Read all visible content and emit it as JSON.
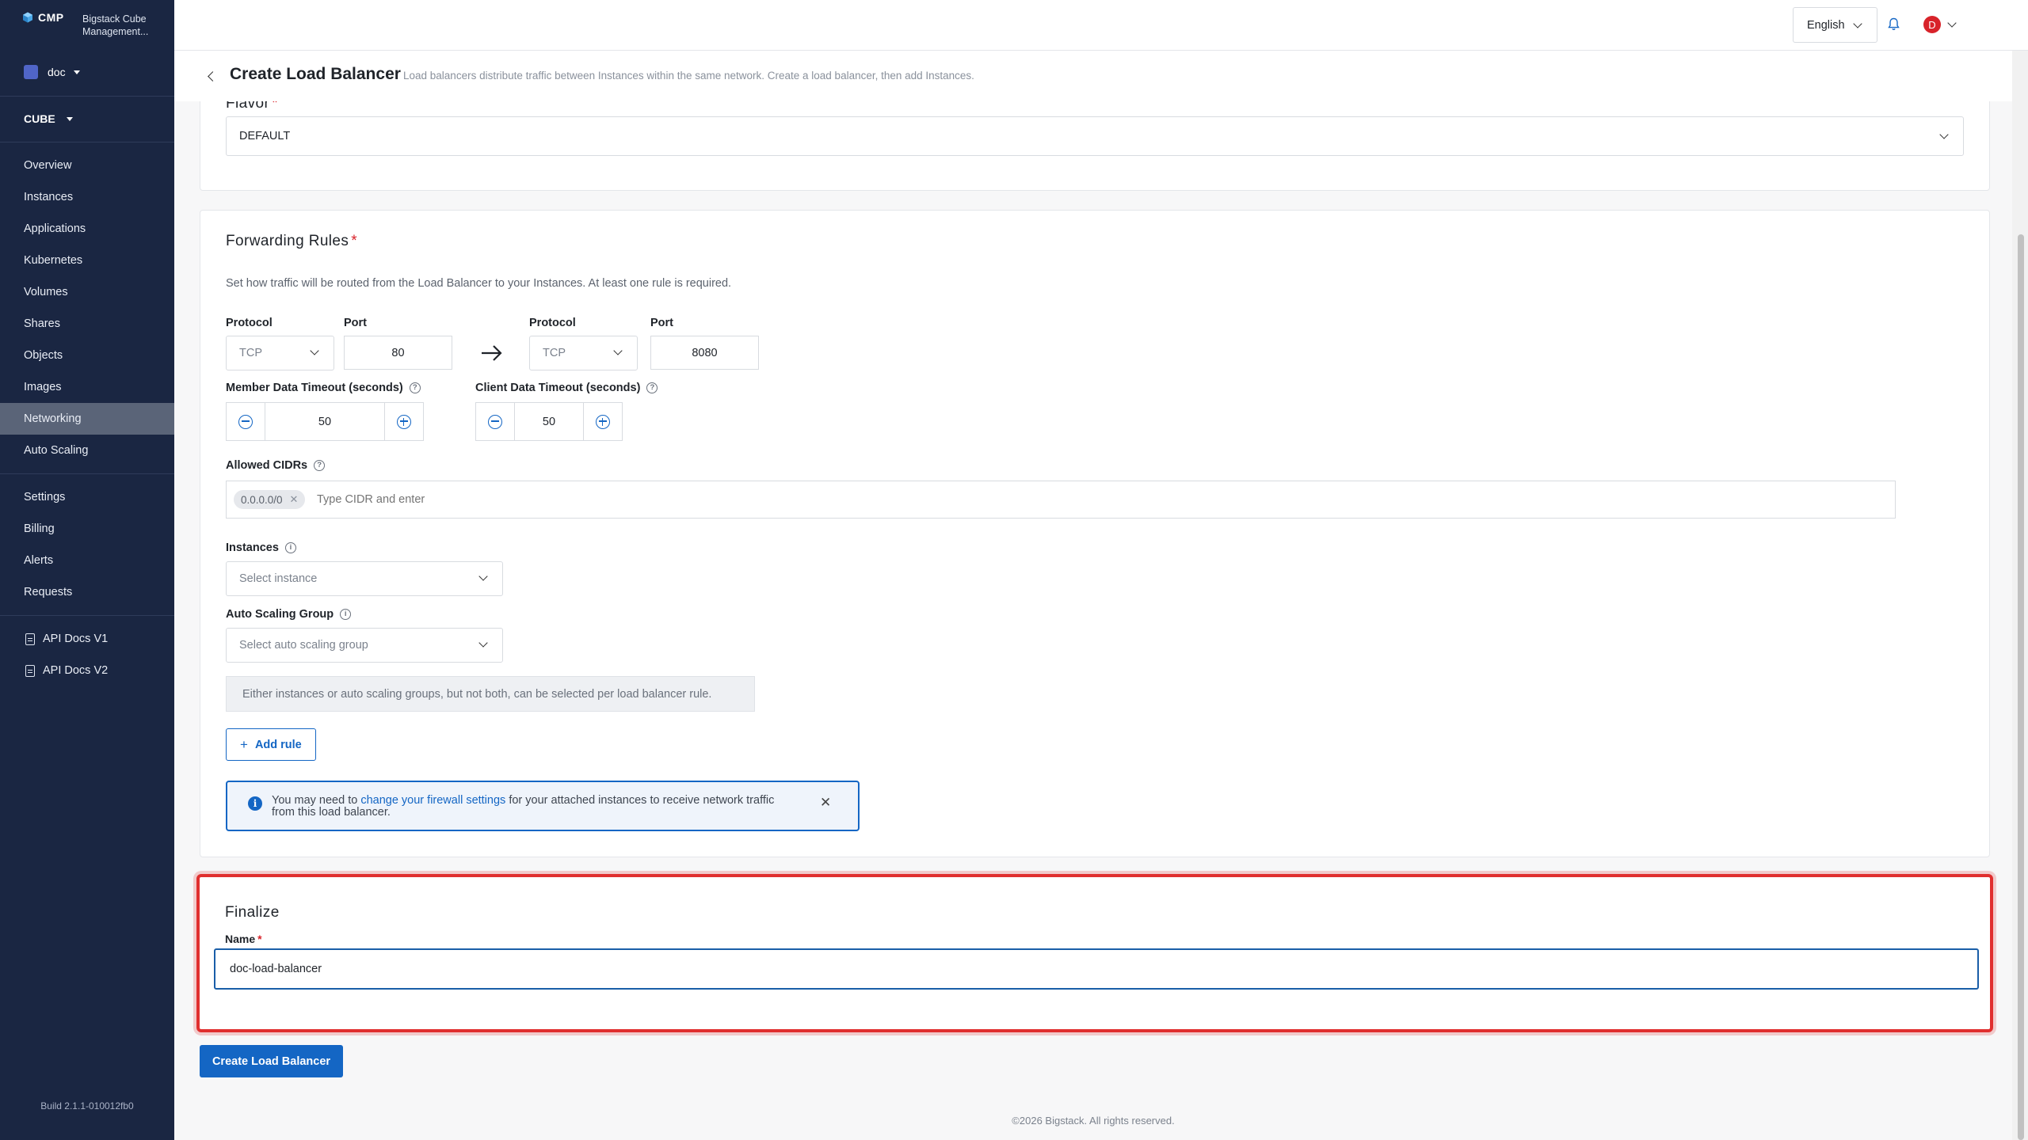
{
  "brand": {
    "short": "CMP",
    "name": "Bigstack Cube Management..."
  },
  "project": {
    "name": "doc"
  },
  "region": {
    "name": "CUBE"
  },
  "sidebar": {
    "items": [
      {
        "label": "Overview"
      },
      {
        "label": "Instances"
      },
      {
        "label": "Applications"
      },
      {
        "label": "Kubernetes"
      },
      {
        "label": "Volumes"
      },
      {
        "label": "Shares"
      },
      {
        "label": "Objects"
      },
      {
        "label": "Images"
      },
      {
        "label": "Networking",
        "active": true
      },
      {
        "label": "Auto Scaling"
      }
    ],
    "settings": [
      {
        "label": "Settings"
      },
      {
        "label": "Billing"
      },
      {
        "label": "Alerts"
      },
      {
        "label": "Requests"
      }
    ],
    "docs": [
      {
        "label": "API Docs V1",
        "icon": "document-icon"
      },
      {
        "label": "API Docs V2",
        "icon": "document-icon"
      }
    ],
    "build": "Build 2.1.1-010012fb0"
  },
  "header": {
    "language": "English",
    "avatar_initial": "D"
  },
  "page": {
    "title": "Create Load Balancer",
    "description": "Load balancers distribute traffic between Instances within the same network. Create a load balancer, then add Instances."
  },
  "flavor": {
    "label": "Flavor",
    "required_mark": "*",
    "value": "DEFAULT"
  },
  "forwarding": {
    "title": "Forwarding Rules",
    "required_mark": "*",
    "description": "Set how traffic will be routed from the Load Balancer to your Instances. At least one rule is required.",
    "protocol_label": "Protocol",
    "port_label": "Port",
    "source": {
      "protocol": "TCP",
      "port": "80"
    },
    "target": {
      "protocol": "TCP",
      "port": "8080"
    },
    "member_timeout": {
      "label": "Member Data Timeout (seconds)",
      "value": "50"
    },
    "client_timeout": {
      "label": "Client Data Timeout (seconds)",
      "value": "50"
    },
    "cidrs": {
      "label": "Allowed CIDRs",
      "tags": [
        "0.0.0.0/0"
      ],
      "placeholder": "Type CIDR and enter"
    },
    "instances": {
      "label": "Instances",
      "placeholder": "Select instance"
    },
    "asg": {
      "label": "Auto Scaling Group",
      "placeholder": "Select auto scaling group"
    },
    "hint": "Either instances or auto scaling groups, but not both, can be selected per load balancer rule.",
    "add_rule": "Add rule",
    "notice": {
      "before": "You may need to ",
      "link": "change your firewall settings",
      "after": " for your attached instances to receive network traffic from this load balancer."
    }
  },
  "finalize": {
    "title": "Finalize",
    "name_label": "Name",
    "required_mark": "*",
    "name_value": "doc-load-balancer"
  },
  "submit_label": "Create Load Balancer",
  "footer": "©2026 Bigstack. All rights reserved.",
  "colors": {
    "sidebar": "#1a2642",
    "primary": "#1466c4",
    "highlight": "#e02e2e",
    "required": "#d8232a"
  }
}
